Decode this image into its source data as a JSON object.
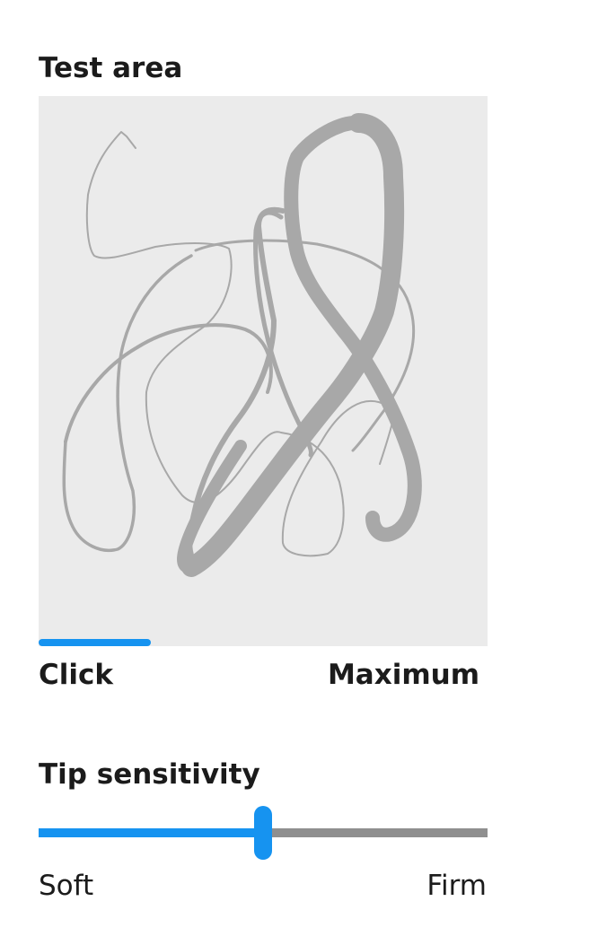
{
  "test_area": {
    "heading": "Test area",
    "pressure_level": 0.25,
    "min_label": "Click",
    "max_label": "Maximum"
  },
  "tip_sensitivity": {
    "heading": "Tip sensitivity",
    "value": 0.5,
    "min_label": "Soft",
    "max_label": "Firm"
  },
  "colors": {
    "accent": "#1693f0",
    "ink": "#a8a8a8",
    "canvas": "#ebebeb",
    "track": "#8f8f8f",
    "text": "#1b1b1b"
  }
}
